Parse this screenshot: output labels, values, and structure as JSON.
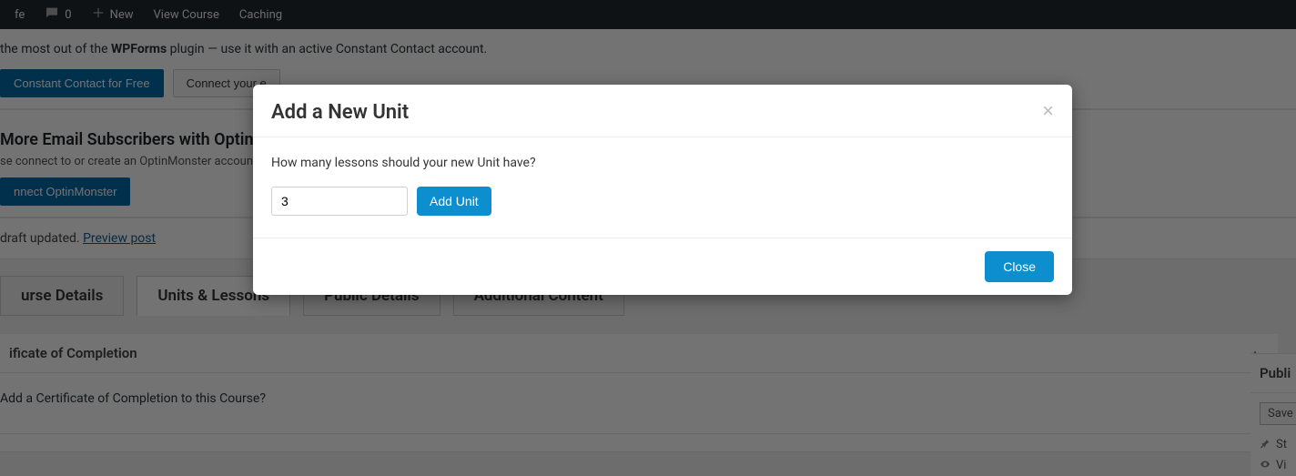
{
  "adminbar": {
    "site_label_partial": "fe",
    "comments_count": "0",
    "new_label": "New",
    "view_course_label": "View Course",
    "caching_label": "Caching"
  },
  "notice_wpforms": {
    "text_prefix": "the most out of the ",
    "plugin_name": "WPForms",
    "text_suffix": " plugin — use it with an active Constant Contact account.",
    "btn_try": "Constant Contact for Free",
    "btn_connect_partial": "Connect your e"
  },
  "notice_optin": {
    "heading": "More Email Subscribers with OptinM",
    "subtext": "se connect to or create an OptinMonster accoun",
    "btn_connect": "nnect OptinMonster"
  },
  "notice_draft": {
    "text": "draft updated. ",
    "preview_label": "Preview post"
  },
  "tabs": {
    "course_details": "urse Details",
    "units_lessons": "Units & Lessons",
    "public_details": "Public Details",
    "additional_content": "Additional Content"
  },
  "panel_cert": {
    "title": "ificate of Completion",
    "question": "Add a Certificate of Completion to this Course?"
  },
  "publish_box": {
    "title": "Publi",
    "save_btn": "Save",
    "status_label": "St",
    "visibility_label": "Vi"
  },
  "modal": {
    "title": "Add a New Unit",
    "close_x": "×",
    "question": "How many lessons should your new Unit have?",
    "input_value": "3",
    "add_btn": "Add Unit",
    "close_btn": "Close"
  }
}
